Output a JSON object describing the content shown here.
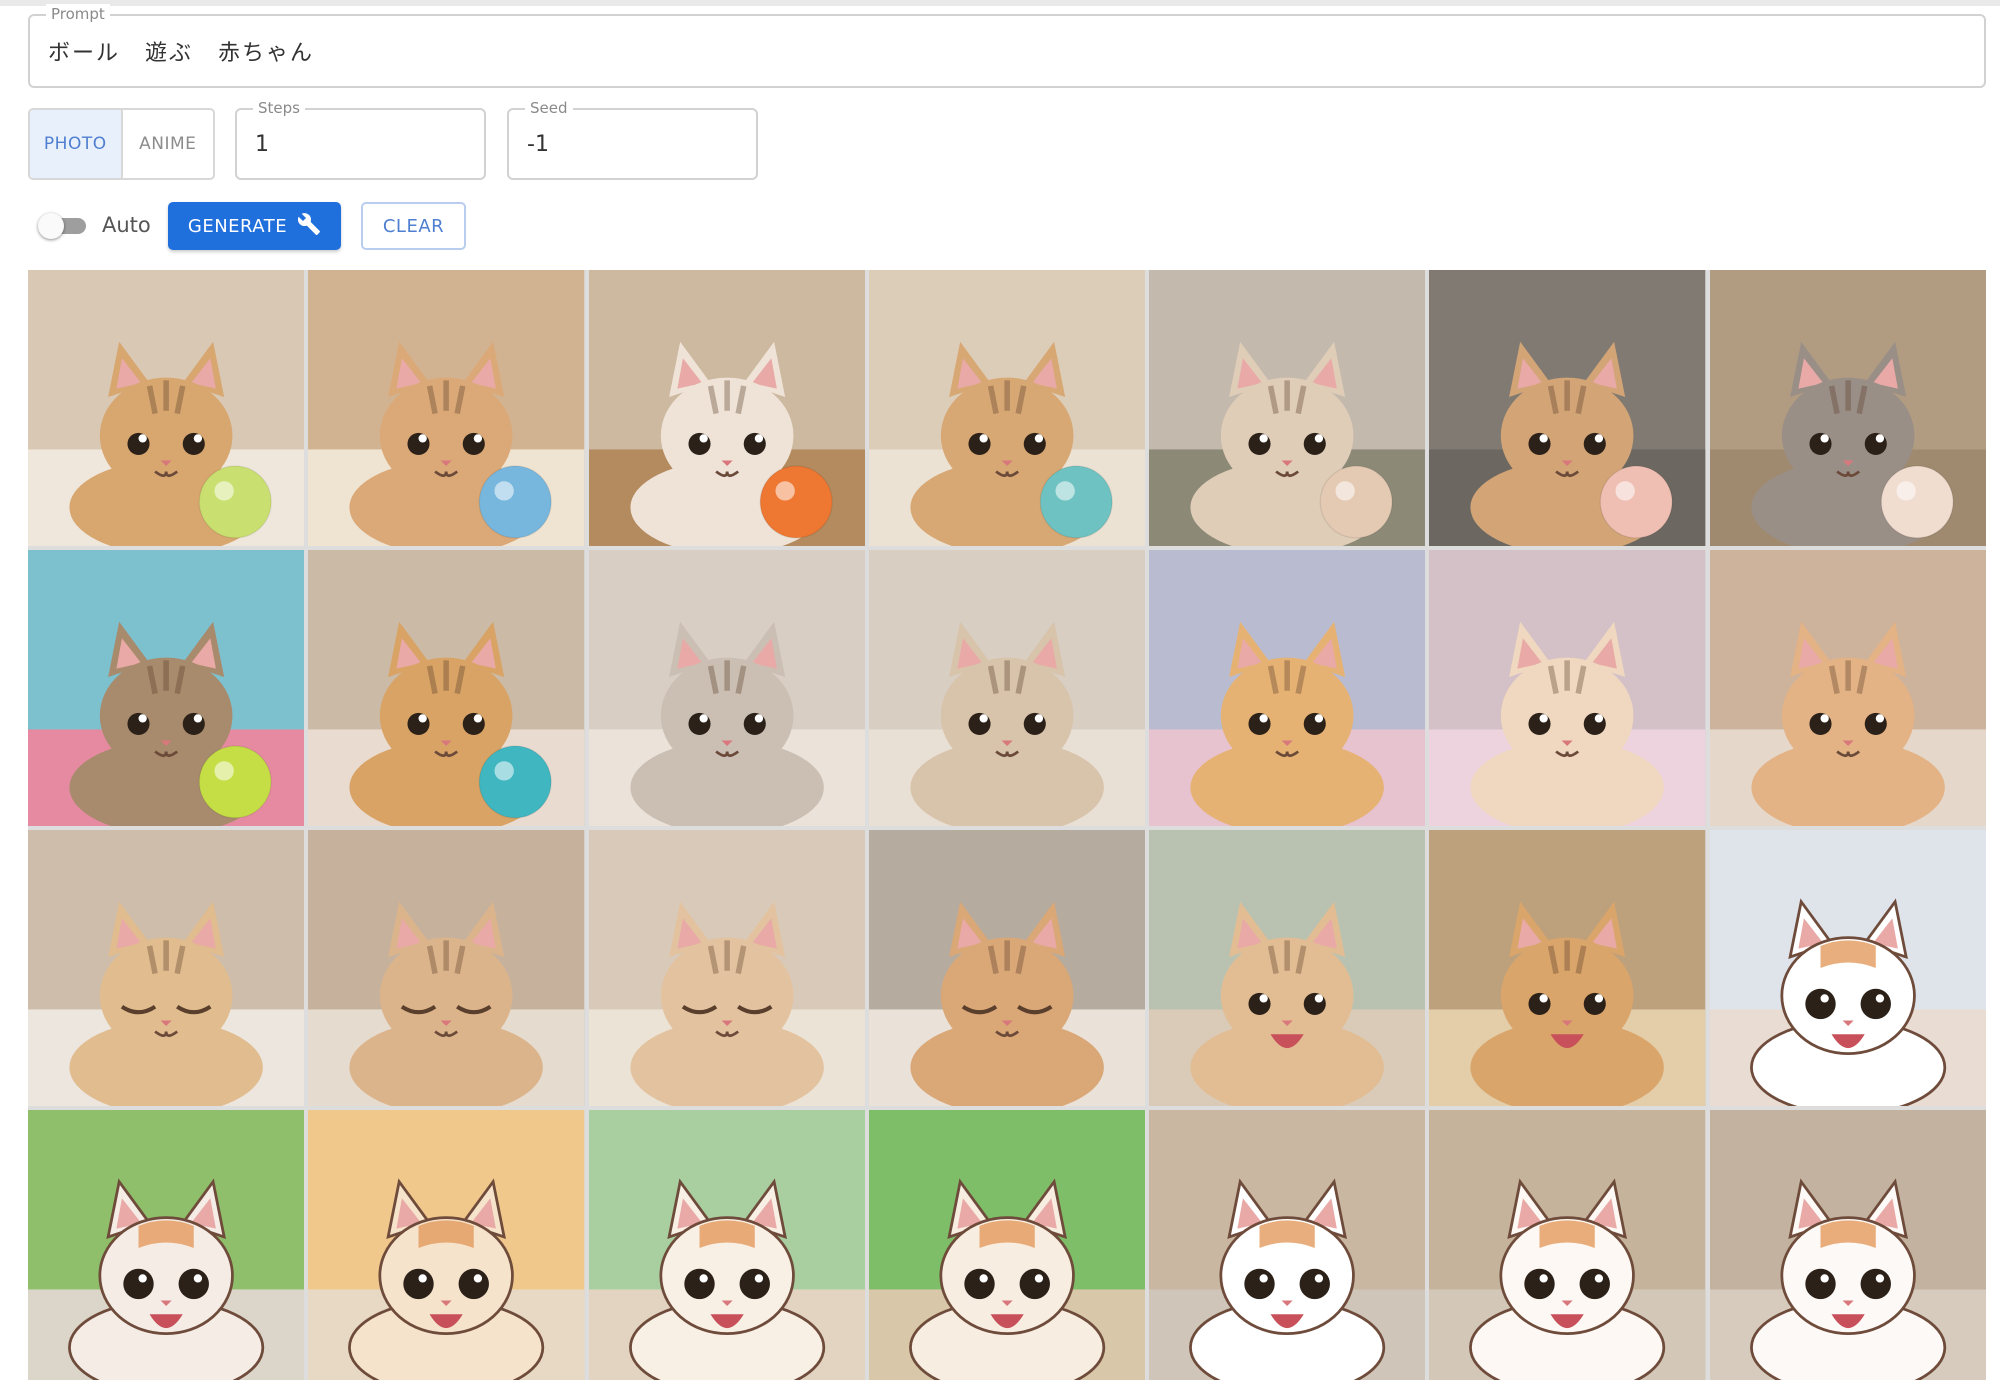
{
  "prompt": {
    "label": "Prompt",
    "value": "ボール 遊ぶ 赤ちゃん"
  },
  "style_toggle": {
    "options": [
      "PHOTO",
      "ANIME"
    ],
    "selected": "PHOTO"
  },
  "steps": {
    "label": "Steps",
    "value": "1"
  },
  "seed": {
    "label": "Seed",
    "value": "-1"
  },
  "auto": {
    "label": "Auto",
    "enabled": false
  },
  "generate_button": {
    "label": "GENERATE",
    "icon": "wrench-icon"
  },
  "clear_button": {
    "label": "CLEAR"
  },
  "gallery": {
    "columns": 7,
    "tiles": [
      {
        "style": "photo",
        "bg": "#d9c8b4",
        "floor": "#efe7dc",
        "cat": "#d8a66f",
        "ball": "#c9e070",
        "mood": "play"
      },
      {
        "style": "photo",
        "bg": "#d2b391",
        "floor": "#efe3d1",
        "cat": "#dba977",
        "ball": "#77b6dd",
        "mood": "play"
      },
      {
        "style": "photo",
        "bg": "#cdb8a0",
        "floor": "#b48b5f",
        "cat": "#eee3d6",
        "ball": "#ee7732",
        "mood": "play"
      },
      {
        "style": "photo",
        "bg": "#dccdb9",
        "floor": "#ece2d4",
        "cat": "#d7a873",
        "ball": "#6ec2c1",
        "mood": "play"
      },
      {
        "style": "photo",
        "bg": "#c3b9ac",
        "floor": "#8c8a77",
        "cat": "#dfcdb8",
        "ball": "#e4c9b3",
        "mood": "play"
      },
      {
        "style": "photo",
        "bg": "#807a72",
        "floor": "#6c6861",
        "cat": "#d2a476",
        "ball": "#f0bfb3",
        "mood": "play"
      },
      {
        "style": "photo",
        "bg": "#b19c82",
        "floor": "#9f8a6f",
        "cat": "#9a8f86",
        "ball": "#f1dcd0",
        "mood": "play"
      },
      {
        "style": "photo",
        "bg": "#7dc1cf",
        "floor": "#e58aa0",
        "cat": "#a88a6c",
        "ball": "#c5de46",
        "mood": "look"
      },
      {
        "style": "photo",
        "bg": "#cbbaa6",
        "floor": "#e9dbd0",
        "cat": "#d8a365",
        "ball": "#3fb6c0",
        "mood": "look"
      },
      {
        "style": "photo",
        "bg": "#d9cec4",
        "floor": "#ebe3da",
        "cat": "#cbbfb3",
        "ball": "",
        "mood": "look"
      },
      {
        "style": "photo",
        "bg": "#d9cec2",
        "floor": "#e9e0d5",
        "cat": "#d8c3ab",
        "ball": "",
        "mood": "look"
      },
      {
        "style": "photo",
        "bg": "#b9bcd0",
        "floor": "#e7c2cf",
        "cat": "#e6b273",
        "ball": "",
        "mood": "look"
      },
      {
        "style": "photo",
        "bg": "#d4c0c7",
        "floor": "#ecd3dd",
        "cat": "#efd8bf",
        "ball": "",
        "mood": "look"
      },
      {
        "style": "photo",
        "bg": "#cdb39c",
        "floor": "#e5d8cb",
        "cat": "#e3b285",
        "ball": "",
        "mood": "look"
      },
      {
        "style": "photo",
        "bg": "#cdbdaa",
        "floor": "#ece6df",
        "cat": "#e1bc8e",
        "ball": "",
        "mood": "sleep"
      },
      {
        "style": "photo",
        "bg": "#c6b29c",
        "floor": "#e5dbcf",
        "cat": "#dcb48b",
        "ball": "",
        "mood": "sleep"
      },
      {
        "style": "photo",
        "bg": "#d8c9b9",
        "floor": "#ece3d7",
        "cat": "#e3c39f",
        "ball": "",
        "mood": "sleep"
      },
      {
        "style": "photo",
        "bg": "#b6ab9f",
        "floor": "#eae2d8",
        "cat": "#daa777",
        "ball": "",
        "mood": "sleep"
      },
      {
        "style": "photo",
        "bg": "#b9c2b1",
        "floor": "#d9cbb8",
        "cat": "#e2bd93",
        "ball": "",
        "mood": "happy"
      },
      {
        "style": "photo",
        "bg": "#bda07c",
        "floor": "#e4cda9",
        "cat": "#daa56b",
        "ball": "",
        "mood": "happy"
      },
      {
        "style": "anime",
        "bg": "#dfe4ea",
        "floor": "#e9dcd2",
        "cat": "#ffffff",
        "ball": "",
        "mood": "happy"
      },
      {
        "style": "anime",
        "bg": "#8fbf6a",
        "floor": "#dcd5c9",
        "cat": "#f5ece6",
        "ball": "",
        "mood": "happy"
      },
      {
        "style": "anime",
        "bg": "#f0c88c",
        "floor": "#e8d9c4",
        "cat": "#f6e3cc",
        "ball": "",
        "mood": "happy"
      },
      {
        "style": "anime",
        "bg": "#a9cfa1",
        "floor": "#e3d4c2",
        "cat": "#f8efe5",
        "ball": "",
        "mood": "happy"
      },
      {
        "style": "anime",
        "bg": "#7fbe68",
        "floor": "#d8c7a9",
        "cat": "#f7ede0",
        "ball": "",
        "mood": "run"
      },
      {
        "style": "anime",
        "bg": "#c9b7a2",
        "floor": "#cfc5b8",
        "cat": "#ffffff",
        "ball": "",
        "mood": "run"
      },
      {
        "style": "anime",
        "bg": "#c5b39c",
        "floor": "#d3c7b7",
        "cat": "#fdf8f3",
        "ball": "",
        "mood": "run"
      },
      {
        "style": "anime",
        "bg": "#c2b29f",
        "floor": "#d6cbbc",
        "cat": "#fdf9f6",
        "ball": "",
        "mood": "run"
      }
    ]
  }
}
